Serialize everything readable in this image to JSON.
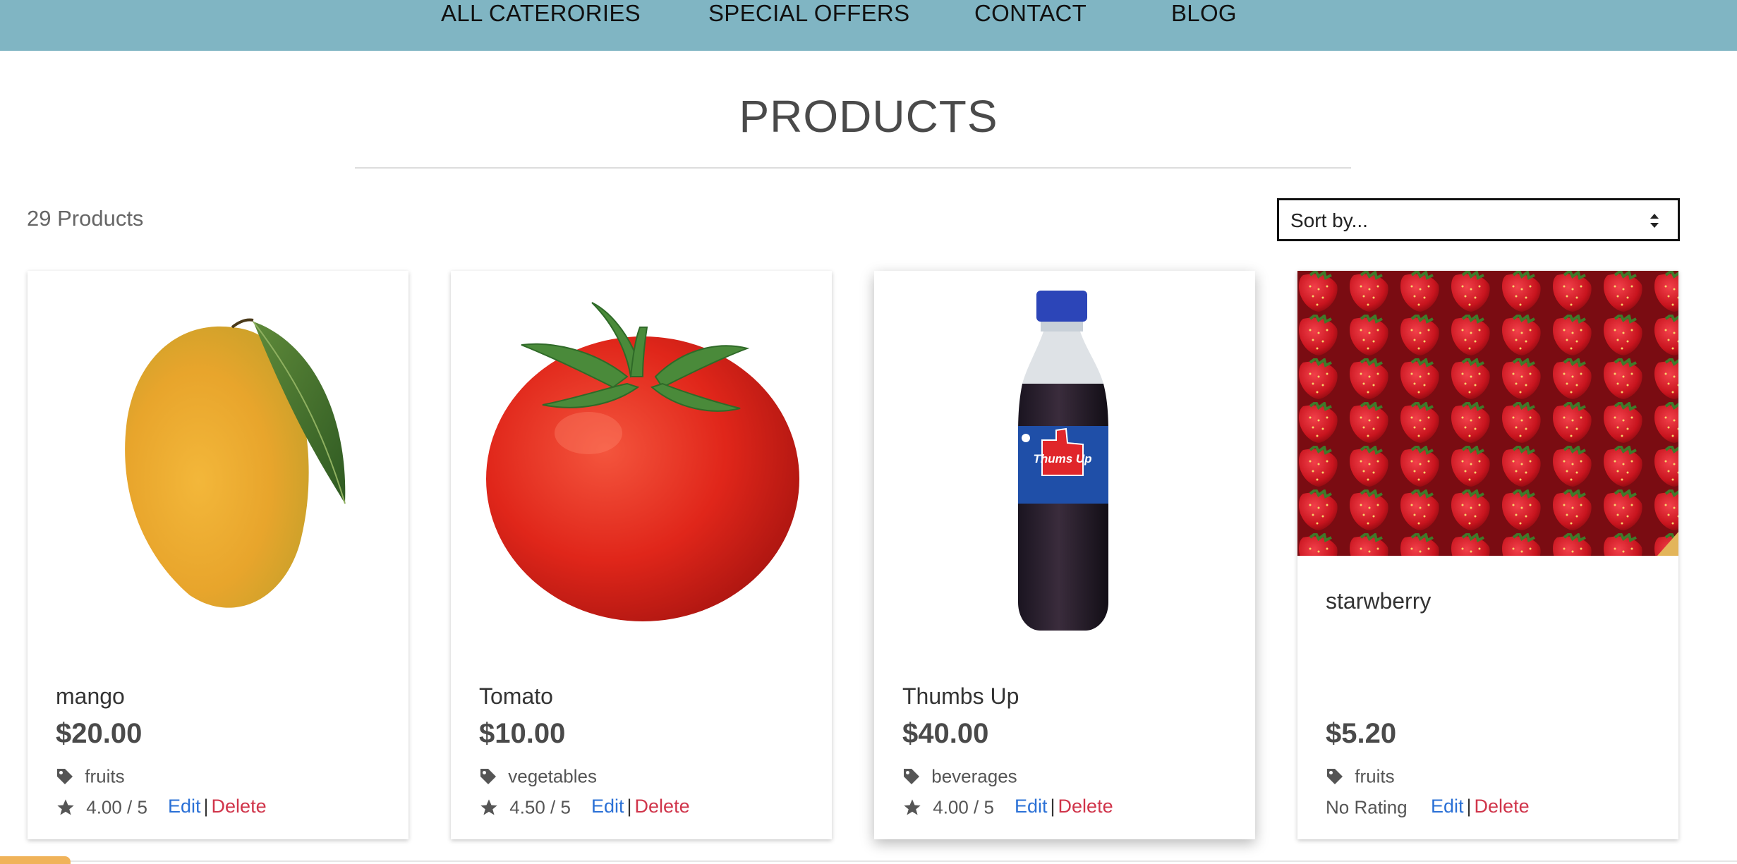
{
  "nav": {
    "items": [
      "ALL CATERORIES",
      "SPECIAL OFFERS",
      "CONTACT",
      "BLOG"
    ]
  },
  "page": {
    "title": "PRODUCTS",
    "count_label": "29 Products"
  },
  "sort": {
    "selected": "Sort by..."
  },
  "actions": {
    "edit": "Edit",
    "separator": "|",
    "delete": "Delete"
  },
  "products": [
    {
      "name": "mango",
      "price": "$20.00",
      "category": "fruits",
      "rating": "4.00 / 5",
      "image": "mango-image"
    },
    {
      "name": "Tomato",
      "price": "$10.00",
      "category": "vegetables",
      "rating": "4.50 / 5",
      "image": "tomato-image"
    },
    {
      "name": "Thumbs Up",
      "price": "$40.00",
      "category": "beverages",
      "rating": "4.00 / 5",
      "image": "thumbs-up-bottle-image"
    },
    {
      "name": "starwberry",
      "price": "$5.20",
      "category": "fruits",
      "rating": "No Rating",
      "image": "strawberry-image"
    }
  ],
  "bottle_label": "Thums Up",
  "colors": {
    "nav_bg": "#80b5c3",
    "edit": "#2a70d6",
    "delete": "#d0344a"
  }
}
